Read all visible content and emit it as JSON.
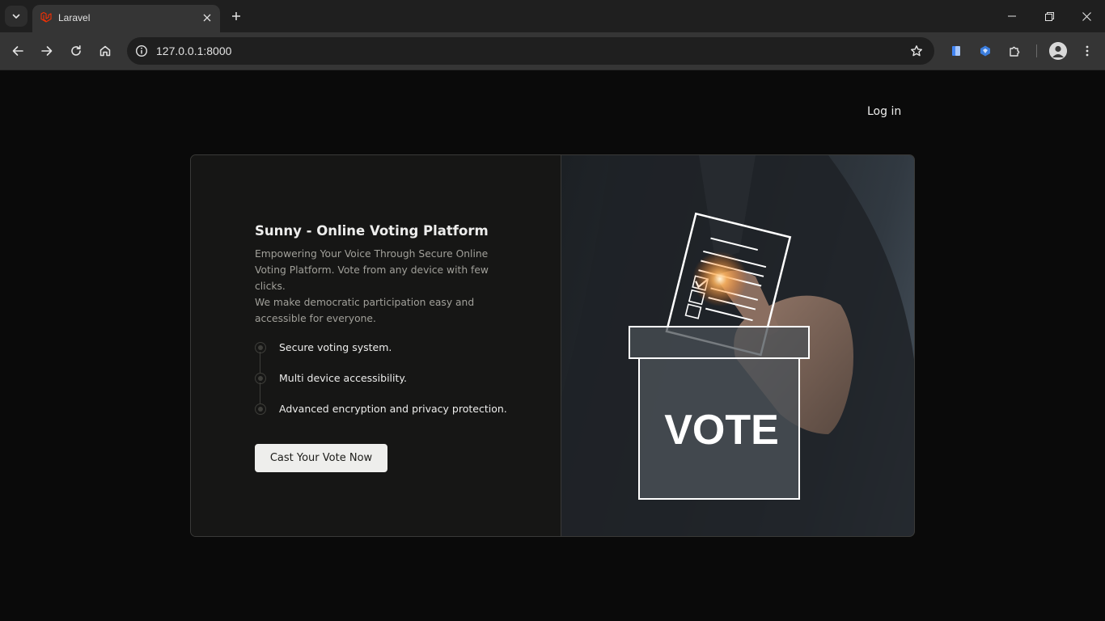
{
  "browser": {
    "tab_title": "Laravel",
    "url": "127.0.0.1:8000",
    "accent": "#f53003"
  },
  "nav": {
    "login_label": "Log in"
  },
  "hero": {
    "title": "Sunny - Online Voting Platform",
    "description_line1": "Empowering Your Voice Through Secure Online Voting Platform. Vote from any device with few clicks.",
    "description_line2": "We make democratic participation easy and accessible for everyone.",
    "features": [
      "Secure voting system.",
      "Multi device accessibility.",
      "Advanced encryption and privacy protection."
    ],
    "cta_label": "Cast Your Vote Now",
    "image_text": "VOTE"
  },
  "icons": {
    "tab_search": "chevron-down-icon",
    "favicon": "laravel-logo-icon",
    "tab_close": "close-icon",
    "new_tab": "plus-icon",
    "back": "arrow-left-icon",
    "forward": "arrow-right-icon",
    "reload": "reload-icon",
    "home": "home-icon",
    "site_info": "info-icon",
    "bookmark": "star-icon",
    "extensions": [
      "document-extension-icon",
      "shield-extension-icon",
      "puzzle-icon"
    ],
    "profile": "avatar",
    "menu": "kebab-menu-icon"
  }
}
